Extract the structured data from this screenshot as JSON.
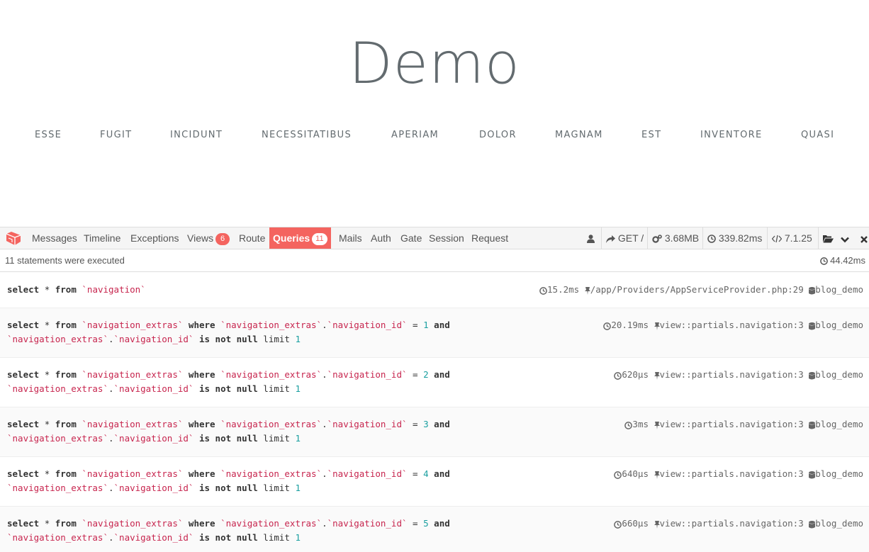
{
  "site": {
    "title": "Demo",
    "nav": [
      "Esse",
      "Fugit",
      "Incidunt",
      "Necessitatibus",
      "Aperiam",
      "Dolor",
      "Magnam",
      "Est",
      "Inventore",
      "Quasi"
    ]
  },
  "debugbar": {
    "tabs": {
      "messages": "Messages",
      "timeline": "Timeline",
      "exceptions": "Exceptions",
      "views": "Views",
      "views_count": "6",
      "route": "Route",
      "queries": "Queries",
      "queries_count": "11",
      "mails": "Mails",
      "auth": "Auth",
      "gate": "Gate",
      "session": "Session",
      "request": "Request"
    },
    "status": {
      "route": "GET /",
      "memory": "3.68MB",
      "time": "339.82ms",
      "php_version": "7.1.25"
    },
    "summary": {
      "statements": "11 statements were executed",
      "total_time": "44.42ms"
    },
    "accent_color": "#f4645f",
    "statements": [
      {
        "id": "1",
        "duration": "15.2ms",
        "source": "/app/Providers/AppServiceProvider.php:29",
        "connection": "blog_demo"
      },
      {
        "id": "1",
        "duration": "20.19ms",
        "source": "view::partials.navigation:3",
        "connection": "blog_demo"
      },
      {
        "id": "2",
        "duration": "620μs",
        "source": "view::partials.navigation:3",
        "connection": "blog_demo"
      },
      {
        "id": "3",
        "duration": "3ms",
        "source": "view::partials.navigation:3",
        "connection": "blog_demo"
      },
      {
        "id": "4",
        "duration": "640μs",
        "source": "view::partials.navigation:3",
        "connection": "blog_demo"
      },
      {
        "id": "5",
        "duration": "660μs",
        "source": "view::partials.navigation:3",
        "connection": "blog_demo"
      }
    ],
    "sql_tokens": {
      "select": "select",
      "star": "*",
      "from": "from",
      "where": "where",
      "and": "and",
      "is": "is",
      "not": "not",
      "null": "null",
      "limit": "limit",
      "limit_value": "1",
      "eq": "=",
      "dot": ".",
      "table_navigation": "`navigation`",
      "table_extras": "`navigation_extras`",
      "col_navigation_id": "`navigation_id`"
    }
  }
}
